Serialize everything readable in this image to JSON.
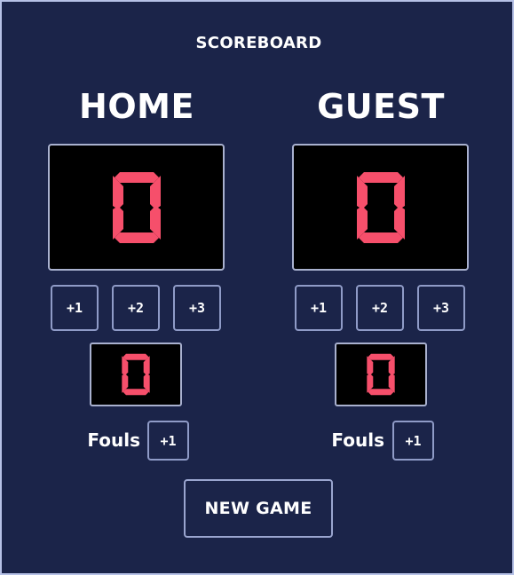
{
  "app": {
    "title": "SCOREBOARD"
  },
  "home": {
    "name": "HOME",
    "score": 0,
    "fouls": 0,
    "points_buttons": [
      "+1",
      "+2",
      "+3"
    ],
    "fouls_label": "Fouls",
    "foul_button": "+1"
  },
  "guest": {
    "name": "GUEST",
    "score": 0,
    "fouls": 0,
    "points_buttons": [
      "+1",
      "+2",
      "+3"
    ],
    "fouls_label": "Fouls",
    "foul_button": "+1"
  },
  "actions": {
    "new_game": "NEW GAME"
  },
  "colors": {
    "background": "#1b2449",
    "display_background": "#000000",
    "digit": "#f64f6b",
    "text": "#ffffff"
  }
}
